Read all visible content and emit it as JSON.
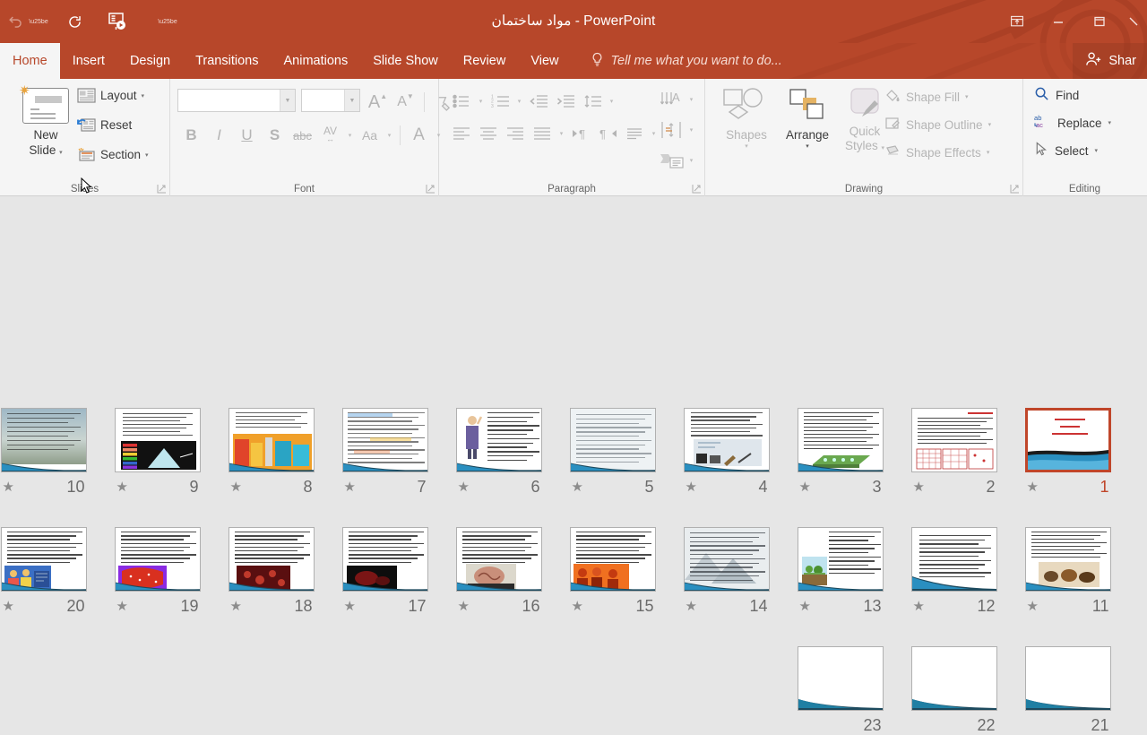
{
  "window": {
    "title": "مواد ساختمان - PowerPoint",
    "titlebar_color": "#b7472a",
    "quick_access": [
      {
        "name": "undo",
        "glyph": "↶",
        "enabled": false
      },
      {
        "name": "redo-repeat",
        "glyph": "↻",
        "enabled": true
      },
      {
        "name": "start-slideshow",
        "glyph": "",
        "enabled": true
      }
    ],
    "controls": {
      "ribbon_display": "⬆",
      "minimize": "–",
      "restore": "⬜",
      "close": "✕"
    }
  },
  "tabs": [
    {
      "label": "Home",
      "active": true
    },
    {
      "label": "Insert",
      "active": false
    },
    {
      "label": "Design",
      "active": false
    },
    {
      "label": "Transitions",
      "active": false
    },
    {
      "label": "Animations",
      "active": false
    },
    {
      "label": "Slide Show",
      "active": false
    },
    {
      "label": "Review",
      "active": false
    },
    {
      "label": "View",
      "active": false
    }
  ],
  "tellme": {
    "placeholder": "Tell me what you want to do...",
    "icon": "lightbulb-icon"
  },
  "share": {
    "label": "Shar",
    "icon": "person-add-icon"
  },
  "ribbon": {
    "slides": {
      "group_label": "Slides",
      "new_slide": "New\nSlide",
      "new_slide_line1": "New",
      "new_slide_line2": "Slide",
      "layout": "Layout",
      "reset": "Reset",
      "section": "Section"
    },
    "font": {
      "group_label": "Font",
      "font_name_value": "",
      "font_size_value": "",
      "buttons": [
        {
          "name": "bold",
          "glyph": "B"
        },
        {
          "name": "italic",
          "glyph": "I"
        },
        {
          "name": "underline",
          "glyph": "U"
        },
        {
          "name": "text-shadow",
          "glyph": "S"
        },
        {
          "name": "strikethrough",
          "glyph": "abc"
        },
        {
          "name": "character-spacing",
          "glyph": "AV"
        },
        {
          "name": "change-case",
          "glyph": "Aa"
        },
        {
          "name": "font-color",
          "glyph": "A"
        }
      ],
      "increase_font": "A",
      "decrease_font": "A",
      "clear_formatting": "clear-formatting-icon"
    },
    "paragraph": {
      "group_label": "Paragraph",
      "row1": [
        "bullets",
        "numbering",
        "decrease-indent",
        "increase-indent",
        "line-spacing"
      ],
      "row2": [
        "align-left",
        "align-center",
        "align-right",
        "justify",
        "columns",
        "ltr-text-direction",
        "rtl-text-direction",
        "paragraph-spacing"
      ],
      "right": [
        "text-direction",
        "align-text",
        "convert-to-smartart"
      ]
    },
    "drawing": {
      "group_label": "Drawing",
      "shapes": "Shapes",
      "arrange": "Arrange",
      "quick_styles_line1": "Quick",
      "quick_styles_line2": "Styles",
      "shape_fill": "Shape Fill",
      "shape_outline": "Shape Outline",
      "shape_effects": "Shape Effects"
    },
    "editing": {
      "group_label": "Editing",
      "find": "Find",
      "replace": "Replace",
      "select": "Select"
    }
  },
  "slide_grid": {
    "selected_number": 1,
    "columns": 10,
    "accent_color": "#c0462a",
    "animation_star": "★",
    "slides": [
      {
        "number": 10,
        "animated": true,
        "style": "photo-trees"
      },
      {
        "number": 9,
        "animated": true,
        "style": "chart-rainbow"
      },
      {
        "number": 8,
        "animated": true,
        "style": "colorful-blocks"
      },
      {
        "number": 7,
        "animated": true,
        "style": "text-highlight"
      },
      {
        "number": 6,
        "animated": true,
        "style": "person-text"
      },
      {
        "number": 5,
        "animated": true,
        "style": "faded-text"
      },
      {
        "number": 4,
        "animated": true,
        "style": "diagram-tools"
      },
      {
        "number": 3,
        "animated": true,
        "style": "green-3d"
      },
      {
        "number": 2,
        "animated": true,
        "style": "grid-tables"
      },
      {
        "number": 1,
        "animated": true,
        "style": "title-slide",
        "selected": true
      },
      {
        "number": 20,
        "animated": true,
        "style": "people-illustration"
      },
      {
        "number": 19,
        "animated": true,
        "style": "red-purple"
      },
      {
        "number": 18,
        "animated": true,
        "style": "dark-red-cells"
      },
      {
        "number": 17,
        "animated": true,
        "style": "black-photo"
      },
      {
        "number": 16,
        "animated": true,
        "style": "brain-photo"
      },
      {
        "number": 15,
        "animated": true,
        "style": "orange-figures"
      },
      {
        "number": 14,
        "animated": true,
        "style": "gray-mountain"
      },
      {
        "number": 13,
        "animated": true,
        "style": "landscape-small"
      },
      {
        "number": 12,
        "animated": true,
        "style": "plain-text-teal"
      },
      {
        "number": 11,
        "animated": true,
        "style": "animals-photo"
      },
      {
        "number": 23,
        "animated": false,
        "style": "blank-swoosh"
      },
      {
        "number": 22,
        "animated": false,
        "style": "blank-swoosh"
      },
      {
        "number": 21,
        "animated": false,
        "style": "blank-swoosh"
      }
    ]
  }
}
